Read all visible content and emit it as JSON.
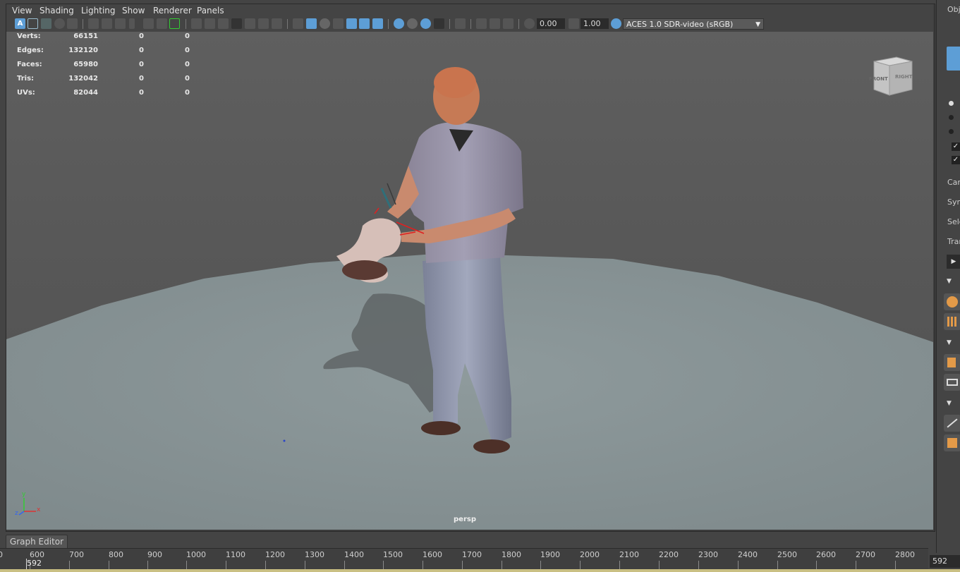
{
  "menu": {
    "view": "View",
    "shading": "Shading",
    "lighting": "Lighting",
    "show": "Show",
    "renderer": "Renderer",
    "panels": "Panels"
  },
  "toolbar": {
    "exposure_value": "0.00",
    "gamma_value": "1.00",
    "color_space": "ACES 1.0 SDR-video (sRGB)"
  },
  "hud": {
    "rows": [
      {
        "label": "Verts:",
        "value": "66151",
        "sel": "0",
        "comp": "0"
      },
      {
        "label": "Edges:",
        "value": "132120",
        "sel": "0",
        "comp": "0"
      },
      {
        "label": "Faces:",
        "value": "65980",
        "sel": "0",
        "comp": "0"
      },
      {
        "label": "Tris:",
        "value": "132042",
        "sel": "0",
        "comp": "0"
      },
      {
        "label": "UVs:",
        "value": "82044",
        "sel": "0",
        "comp": "0"
      }
    ]
  },
  "viewcube": {
    "front": "FRONT",
    "right": "RIGHT"
  },
  "camera_label": "persp",
  "axis": {
    "x": "x",
    "y": "y",
    "z": "z"
  },
  "right_panel": {
    "title": "Obje",
    "cam": "Cam",
    "sym": "Sym",
    "sele": "Sele",
    "tran": "Tran"
  },
  "graph_editor_tab": "Graph Editor",
  "timeline": {
    "ticks": [
      "600",
      "700",
      "800",
      "900",
      "1000",
      "1100",
      "1200",
      "1300",
      "1400",
      "1500",
      "1600",
      "1700",
      "1800",
      "1900",
      "2000",
      "2100",
      "2200",
      "2300",
      "2400",
      "2500",
      "2600",
      "2700",
      "2800"
    ],
    "current_marker": "592",
    "current_frame": "592"
  },
  "colors": {
    "floor": "#8a9597",
    "accent_blue": "#5d9ed6",
    "timeline_yellow": "#c9bf82"
  }
}
